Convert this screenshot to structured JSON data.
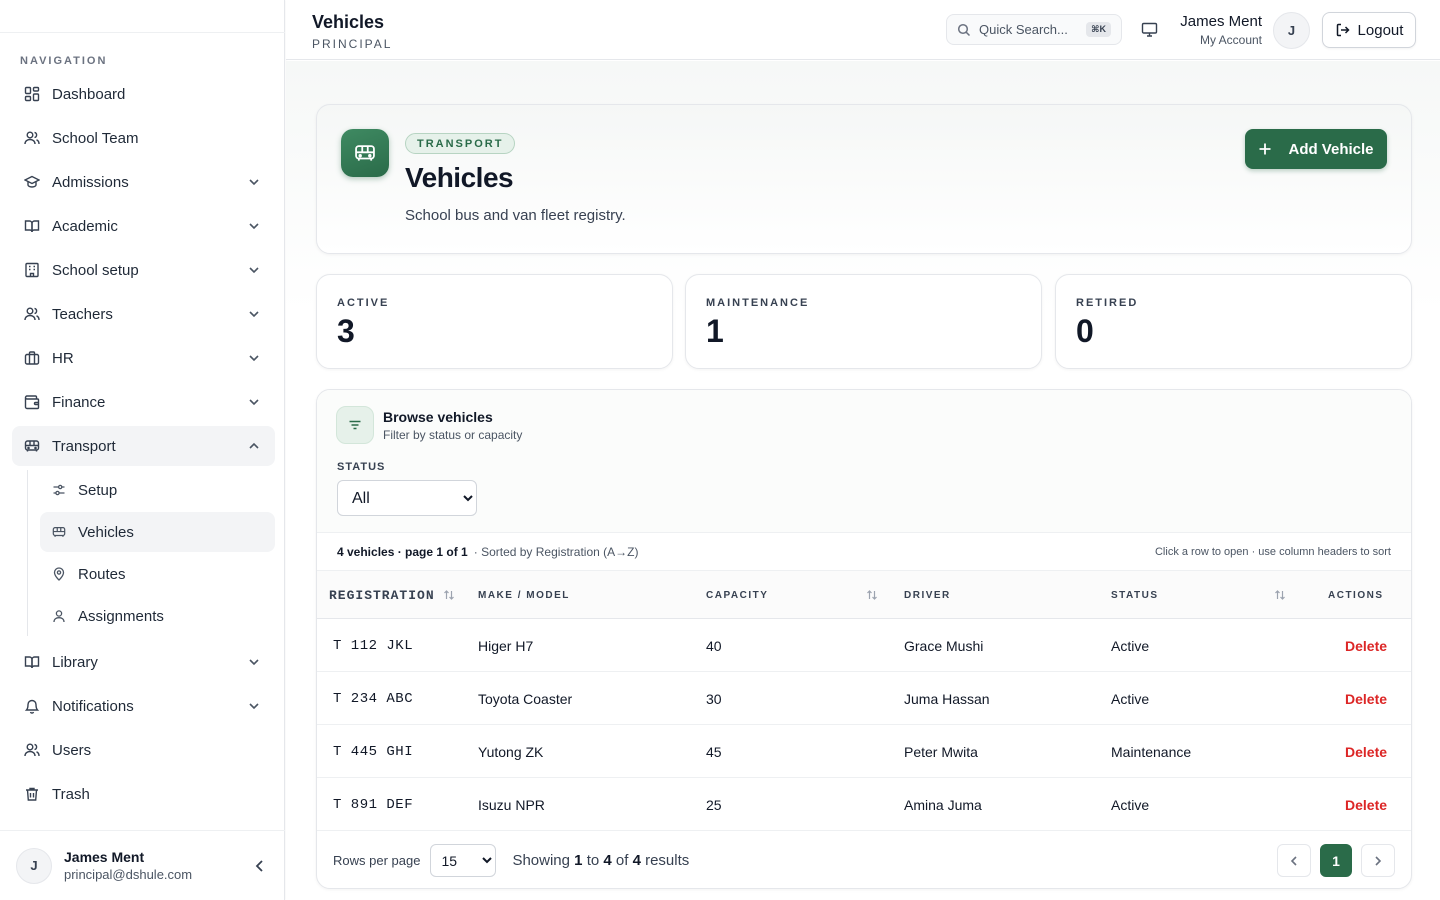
{
  "sidebar": {
    "heading": "NAVIGATION",
    "items": [
      {
        "label": "Dashboard"
      },
      {
        "label": "School Team"
      },
      {
        "label": "Admissions"
      },
      {
        "label": "Academic"
      },
      {
        "label": "School setup"
      },
      {
        "label": "Teachers"
      },
      {
        "label": "HR"
      },
      {
        "label": "Finance"
      },
      {
        "label": "Transport"
      },
      {
        "label": "Library"
      },
      {
        "label": "Notifications"
      },
      {
        "label": "Users"
      },
      {
        "label": "Trash"
      }
    ],
    "transport_sub": [
      {
        "label": "Setup"
      },
      {
        "label": "Vehicles"
      },
      {
        "label": "Routes"
      },
      {
        "label": "Assignments"
      }
    ],
    "footer": {
      "initial": "J",
      "name": "James Ment",
      "email": "principal@dshule.com"
    }
  },
  "header": {
    "title": "Vehicles",
    "subtitle": "PRINCIPAL",
    "search_placeholder": "Quick Search...",
    "search_shortcut": "⌘K",
    "user_name": "James Ment",
    "user_account": "My Account",
    "user_initial": "J",
    "logout_label": "Logout"
  },
  "hero": {
    "badge": "TRANSPORT",
    "title": "Vehicles",
    "description": "School bus and van fleet registry.",
    "add_label": "Add Vehicle"
  },
  "stats": [
    {
      "label": "ACTIVE",
      "value": "3"
    },
    {
      "label": "MAINTENANCE",
      "value": "1"
    },
    {
      "label": "RETIRED",
      "value": "0"
    }
  ],
  "browse": {
    "title": "Browse vehicles",
    "subtitle": "Filter by status or capacity",
    "status_label": "STATUS",
    "status_value": "All",
    "count_text": "4 vehicles · page 1 of 1",
    "sort_text": "· Sorted by Registration (A→Z)",
    "hint_text": "Click a row to open · use column headers to sort"
  },
  "table": {
    "columns": {
      "registration": "REGISTRATION",
      "make_model": "MAKE / MODEL",
      "capacity": "CAPACITY",
      "driver": "DRIVER",
      "status": "STATUS",
      "actions": "ACTIONS"
    },
    "rows": [
      {
        "registration": "T 112 JKL",
        "make_model": "Higer H7",
        "capacity": "40",
        "driver": "Grace Mushi",
        "status": "Active",
        "action": "Delete"
      },
      {
        "registration": "T 234 ABC",
        "make_model": "Toyota Coaster",
        "capacity": "30",
        "driver": "Juma Hassan",
        "status": "Active",
        "action": "Delete"
      },
      {
        "registration": "T 445 GHI",
        "make_model": "Yutong ZK",
        "capacity": "45",
        "driver": "Peter Mwita",
        "status": "Maintenance",
        "action": "Delete"
      },
      {
        "registration": "T 891 DEF",
        "make_model": "Isuzu NPR",
        "capacity": "25",
        "driver": "Amina Juma",
        "status": "Active",
        "action": "Delete"
      }
    ]
  },
  "pagination": {
    "rows_per_page_label": "Rows per page",
    "rows_per_page_value": "15",
    "showing_prefix": "Showing",
    "from": "1",
    "to_word": "to",
    "to": "4",
    "of_word": "of",
    "total": "4",
    "results_word": "results",
    "current_page": "1"
  },
  "colors": {
    "accent": "#2a6b49",
    "danger": "#dc2626"
  }
}
